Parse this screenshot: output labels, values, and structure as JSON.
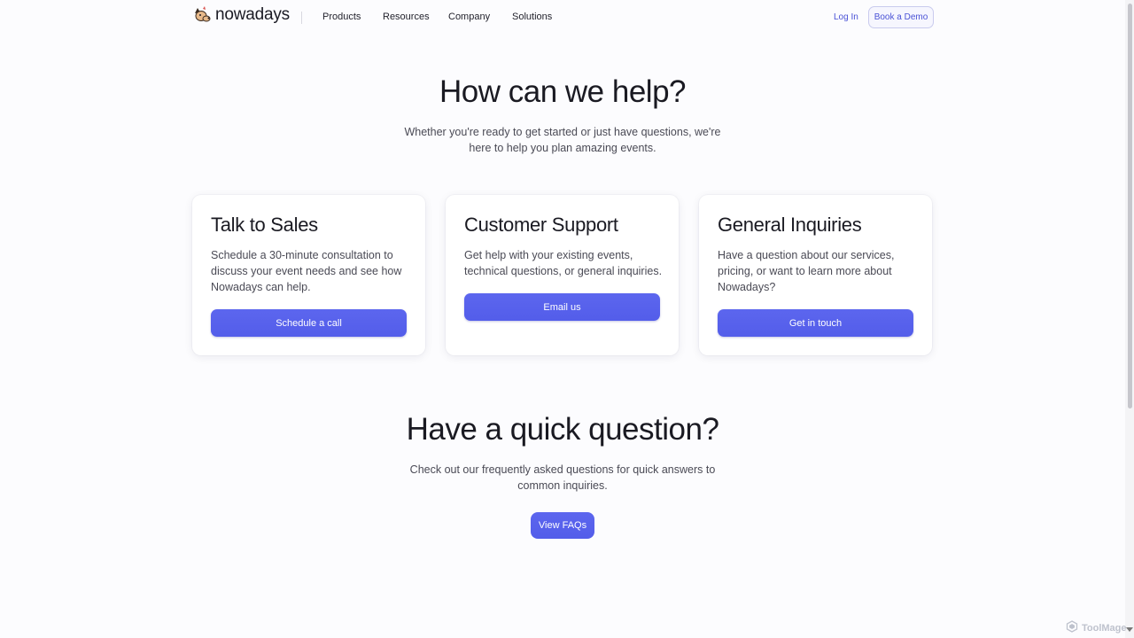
{
  "brand": {
    "name": "nowadays",
    "logo_icon": "dog-logo-icon"
  },
  "nav": {
    "links": [
      "Products",
      "Resources",
      "Company",
      "Solutions"
    ],
    "login": "Log In",
    "demo": "Book a Demo"
  },
  "hero": {
    "title": "How can we help?",
    "subtitle": "Whether you're ready to get started or just have questions, we're here to help you plan amazing events."
  },
  "cards": [
    {
      "title": "Talk to Sales",
      "description": "Schedule a 30-minute consultation to discuss your event needs and see how Nowadays can help.",
      "button": "Schedule a call"
    },
    {
      "title": "Customer Support",
      "description": "Get help with your existing events, technical questions, or general inquiries.",
      "button": "Email us"
    },
    {
      "title": "General Inquiries",
      "description": "Have a question about our services, pricing, or want to learn more about Nowadays?",
      "button": "Get in touch"
    }
  ],
  "faq": {
    "title": "Have a quick question?",
    "subtitle": "Check out our frequently asked questions for quick answers to common inquiries.",
    "button": "View FAQs"
  },
  "watermark": {
    "text": "ToolMage",
    "icon": "toolmage-logo-icon"
  },
  "colors": {
    "accent": "#535dea",
    "background": "#fcfcfe",
    "text": "#1a1a22"
  }
}
